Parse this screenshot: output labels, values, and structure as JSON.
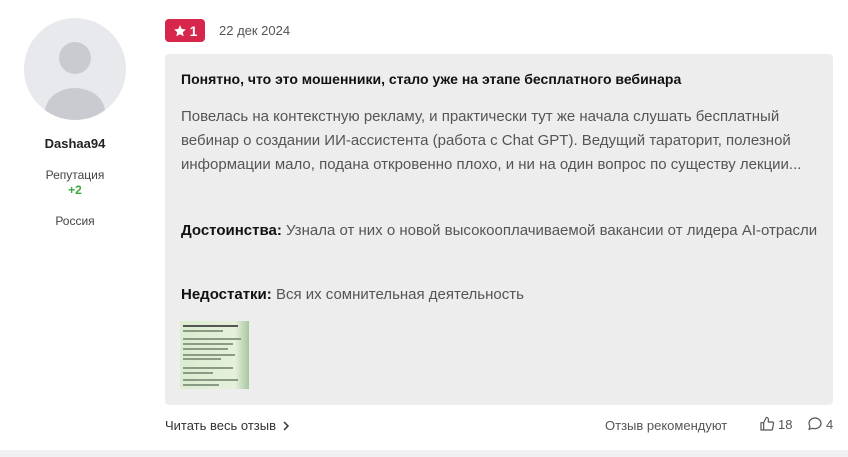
{
  "author": {
    "username": "Dashaa94",
    "reputation_label": "Репутация",
    "reputation_value": "+2",
    "country": "Россия"
  },
  "review": {
    "rating": "1",
    "date": "22 дек 2024",
    "title": "Понятно, что это мошенники, стало уже на этапе бесплатного вебинара",
    "body": "Повелась на контекстную рекламу, и практически тут же начала слушать бесплатный вебинар о создании ИИ-ассистента (работа с Chat GPT). Ведущий тараторит, полезной информации мало, подана откровенно плохо, и ни на один вопрос по существу лекции...",
    "pros_label": "Достоинства:",
    "pros_text": "Узнала от них о новой высокооплачиваемой вакансии от лидера AI-отрасли",
    "cons_label": "Недостатки:",
    "cons_text": "Вся их сомнительная деятельность"
  },
  "footer": {
    "read_more": "Читать весь отзыв",
    "recommend_text": "Отзыв рекомендуют",
    "likes": "18",
    "comments": "4"
  },
  "colors": {
    "rating_badge": "#d7264b",
    "reputation_positive": "#3aa93a",
    "bubble_bg": "#ededee"
  }
}
